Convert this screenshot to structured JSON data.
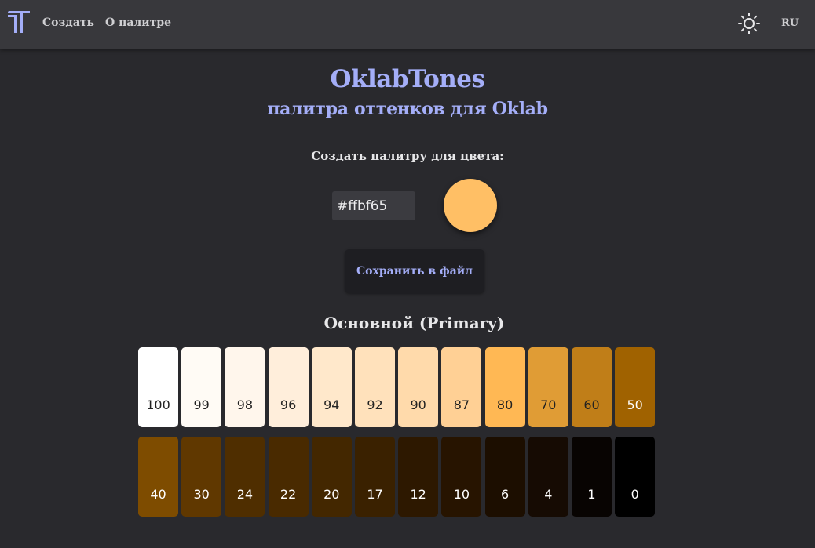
{
  "nav": {
    "create": "Создать",
    "about": "О палитре",
    "lang": "RU",
    "logo_icon": "logo-icon",
    "theme_icon": "sun-icon"
  },
  "hero": {
    "title": "OklabTones",
    "subtitle": "палитра оттенков для Oklab"
  },
  "form": {
    "prompt": "Создать палитру для цвета:",
    "color_value": "#ffbf65",
    "save_label": "Сохранить в файл"
  },
  "palette": {
    "title": "Основной (Primary)",
    "tones": [
      {
        "label": "100",
        "color": "#ffffff",
        "text": "#222222"
      },
      {
        "label": "99",
        "color": "#fffbf5",
        "text": "#222222"
      },
      {
        "label": "98",
        "color": "#fff6ec",
        "text": "#222222"
      },
      {
        "label": "96",
        "color": "#ffeedb",
        "text": "#222222"
      },
      {
        "label": "94",
        "color": "#ffe8cb",
        "text": "#222222"
      },
      {
        "label": "92",
        "color": "#ffe1bb",
        "text": "#222222"
      },
      {
        "label": "90",
        "color": "#ffdaab",
        "text": "#222222"
      },
      {
        "label": "87",
        "color": "#ffd095",
        "text": "#222222"
      },
      {
        "label": "80",
        "color": "#ffb854",
        "text": "#222222"
      },
      {
        "label": "70",
        "color": "#e09c35",
        "text": "#222222"
      },
      {
        "label": "60",
        "color": "#c07e18",
        "text": "#222222"
      },
      {
        "label": "50",
        "color": "#a06200",
        "text": "#ffffff"
      },
      {
        "label": "40",
        "color": "#7e4c00",
        "text": "#ffffff"
      },
      {
        "label": "30",
        "color": "#603800",
        "text": "#ffffff"
      },
      {
        "label": "24",
        "color": "#4f2e00",
        "text": "#ffffff"
      },
      {
        "label": "22",
        "color": "#492a00",
        "text": "#ffffff"
      },
      {
        "label": "20",
        "color": "#432700",
        "text": "#ffffff"
      },
      {
        "label": "17",
        "color": "#3a2100",
        "text": "#ffffff"
      },
      {
        "label": "12",
        "color": "#2d1800",
        "text": "#ffffff"
      },
      {
        "label": "10",
        "color": "#271400",
        "text": "#ffffff"
      },
      {
        "label": "6",
        "color": "#1c0e00",
        "text": "#ffffff"
      },
      {
        "label": "4",
        "color": "#160b03",
        "text": "#ffffff"
      },
      {
        "label": "1",
        "color": "#080402",
        "text": "#ffffff"
      },
      {
        "label": "0",
        "color": "#000000",
        "text": "#ffffff"
      }
    ]
  },
  "colors": {
    "accent": "#a4aef8",
    "background": "#29292d",
    "topbar": "#38383c",
    "source_color": "#ffbf65"
  }
}
